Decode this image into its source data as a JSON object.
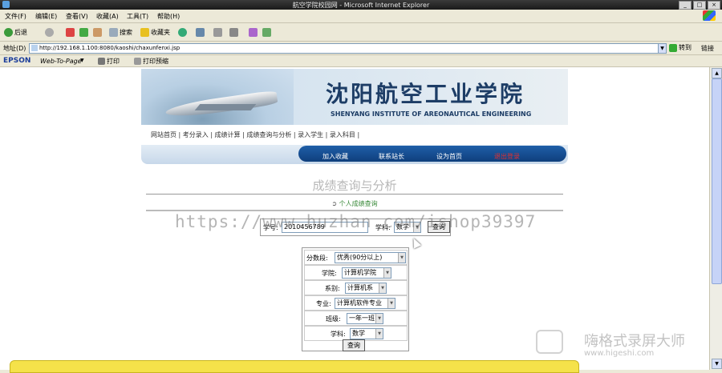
{
  "window": {
    "title": "航空学院校园网 - Microsoft Internet Explorer",
    "controls": [
      "_",
      "□",
      "×"
    ]
  },
  "menu": [
    "文件(F)",
    "编辑(E)",
    "查看(V)",
    "收藏(A)",
    "工具(T)",
    "帮助(H)"
  ],
  "toolbar": {
    "back": "后退",
    "search": "搜索",
    "favorites": "收藏夹"
  },
  "address": {
    "label": "地址(D)",
    "url": "http://192.168.1.100:8080/kaoshi/chaxunfenxi.jsp",
    "go": "转到",
    "links": "链接"
  },
  "linksbar": {
    "brand": "EPSON",
    "web_to_page": "Web-To-Page",
    "print": "打印",
    "print_preview": "打印预缩"
  },
  "site": {
    "name_cn": "沈阳航空工业学院",
    "name_en": "SHENYANG INSTITUTE OF AREONAUTICAL ENGINEERING",
    "nav": "网站首页 | 考分录入 | 成绩计算 | 成绩查询与分析 | 录入学生 | 录入科目 |",
    "pill_links": [
      "加入收藏",
      "联系站长",
      "设为首页",
      "退出登录"
    ]
  },
  "page": {
    "title": "成绩查询与分析",
    "sublink": "个人成绩查询"
  },
  "query": {
    "student_id_label": "学号:",
    "student_id_value": "2010456789",
    "subject_label": "学科:",
    "subject_value": "数学",
    "submit": "查询"
  },
  "filter": {
    "score_label": "分数段:",
    "score_value": "优秀(90分以上)",
    "college_label": "学院:",
    "college_value": "计算机学院",
    "dept_label": "系别:",
    "dept_value": "计算机系",
    "major_label": "专业:",
    "major_value": "计算机软件专业",
    "class_label": "班级:",
    "class_value": "一年一班",
    "subject_label": "学科:",
    "subject_value": "数学",
    "submit": "查询"
  },
  "watermarks": {
    "url": "https://www.huzhan.com/ishop39397",
    "recorder": "嗨格式录屏大师",
    "recorder_url": "www.higeshi.com"
  }
}
